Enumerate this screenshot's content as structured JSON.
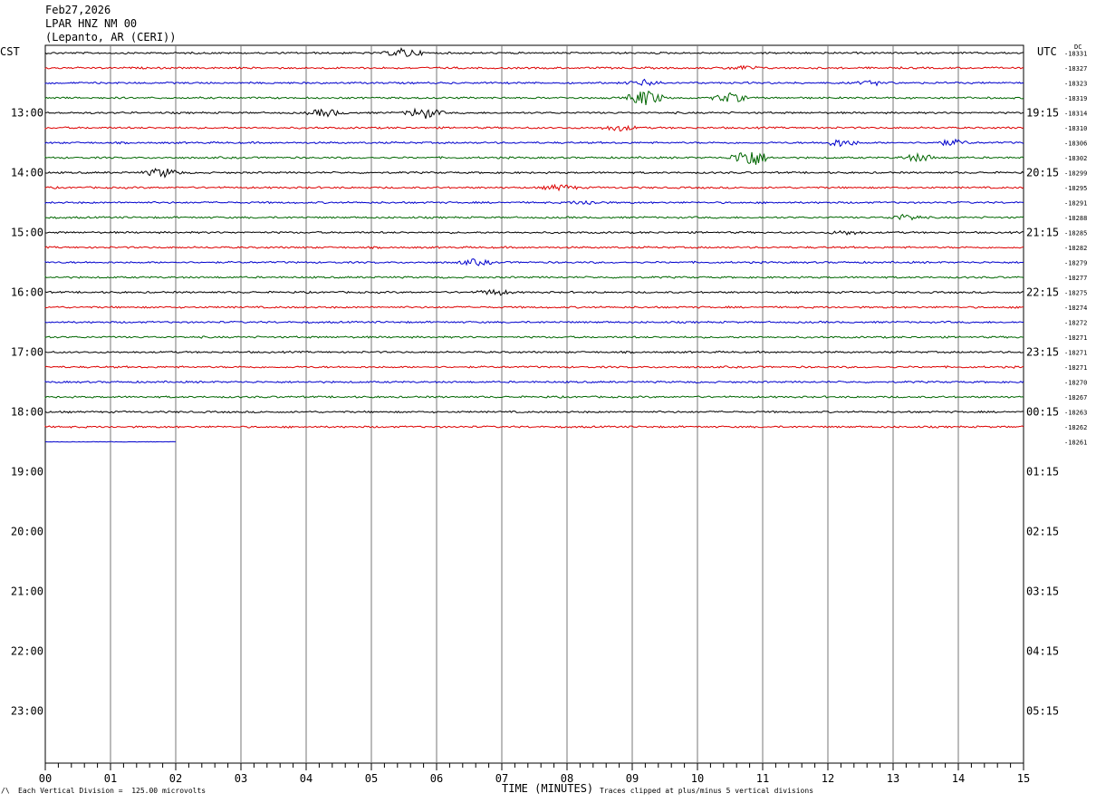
{
  "header": {
    "date": "Feb27,2026",
    "station": "LPAR HNZ NM 00",
    "location": "(Lepanto, AR (CERI))"
  },
  "timezones": {
    "left": "CST",
    "right": "UTC"
  },
  "dc_label": "DC",
  "footer": {
    "left": "Each Vertical Division =  125.00 microvolts",
    "center": "TIME (MINUTES)",
    "right": "Traces clipped at plus/minus 5 vertical divisions",
    "corner": "/\\"
  },
  "chart_data": {
    "type": "line",
    "title": "LPAR HNZ NM 00",
    "xlabel": "TIME (MINUTES)",
    "xlim": [
      0,
      15
    ],
    "x_ticks": [
      "00",
      "01",
      "02",
      "03",
      "04",
      "05",
      "06",
      "07",
      "08",
      "09",
      "10",
      "11",
      "12",
      "13",
      "14",
      "15"
    ],
    "left_hour_labels": [
      "13:00",
      "14:00",
      "15:00",
      "16:00",
      "17:00",
      "18:00",
      "19:00",
      "20:00",
      "21:00",
      "22:00",
      "23:00"
    ],
    "right_hour_labels": [
      "19:15",
      "20:15",
      "21:15",
      "22:15",
      "23:15",
      "00:15",
      "01:15",
      "02:15",
      "03:15",
      "04:15",
      "05:15"
    ],
    "trace_colors": [
      "#000000",
      "#dd0000",
      "#0000cc",
      "#006600"
    ],
    "dc_offsets": [
      "-18331",
      "-18327",
      "-18323",
      "-18319",
      "-18314",
      "-18310",
      "-18306",
      "-18302",
      "-18299",
      "-18295",
      "-18291",
      "-18288",
      "-18285",
      "-18282",
      "-18279",
      "-18277",
      "-18275",
      "-18274",
      "-18272",
      "-18271",
      "-18271",
      "-18271",
      "-18270",
      "-18267",
      "-18263",
      "-18262",
      "-18261"
    ],
    "last_trace_end_minute": 2,
    "events": [
      {
        "trace": 0,
        "minute": 5.5,
        "amp": 5
      },
      {
        "trace": 1,
        "minute": 10.7,
        "amp": 2
      },
      {
        "trace": 2,
        "minute": 9.2,
        "amp": 3
      },
      {
        "trace": 2,
        "minute": 12.7,
        "amp": 2
      },
      {
        "trace": 3,
        "minute": 9.2,
        "amp": 9
      },
      {
        "trace": 3,
        "minute": 10.5,
        "amp": 5
      },
      {
        "trace": 4,
        "minute": 4.3,
        "amp": 4
      },
      {
        "trace": 4,
        "minute": 5.8,
        "amp": 6
      },
      {
        "trace": 5,
        "minute": 8.8,
        "amp": 3
      },
      {
        "trace": 6,
        "minute": 12.2,
        "amp": 4
      },
      {
        "trace": 6,
        "minute": 13.9,
        "amp": 3
      },
      {
        "trace": 7,
        "minute": 10.8,
        "amp": 11
      },
      {
        "trace": 7,
        "minute": 13.4,
        "amp": 4
      },
      {
        "trace": 8,
        "minute": 1.8,
        "amp": 5
      },
      {
        "trace": 9,
        "minute": 7.9,
        "amp": 3
      },
      {
        "trace": 10,
        "minute": 8.3,
        "amp": 2
      },
      {
        "trace": 11,
        "minute": 13.2,
        "amp": 3
      },
      {
        "trace": 12,
        "minute": 12.3,
        "amp": 2
      },
      {
        "trace": 14,
        "minute": 6.6,
        "amp": 3
      },
      {
        "trace": 16,
        "minute": 6.9,
        "amp": 3
      }
    ]
  }
}
